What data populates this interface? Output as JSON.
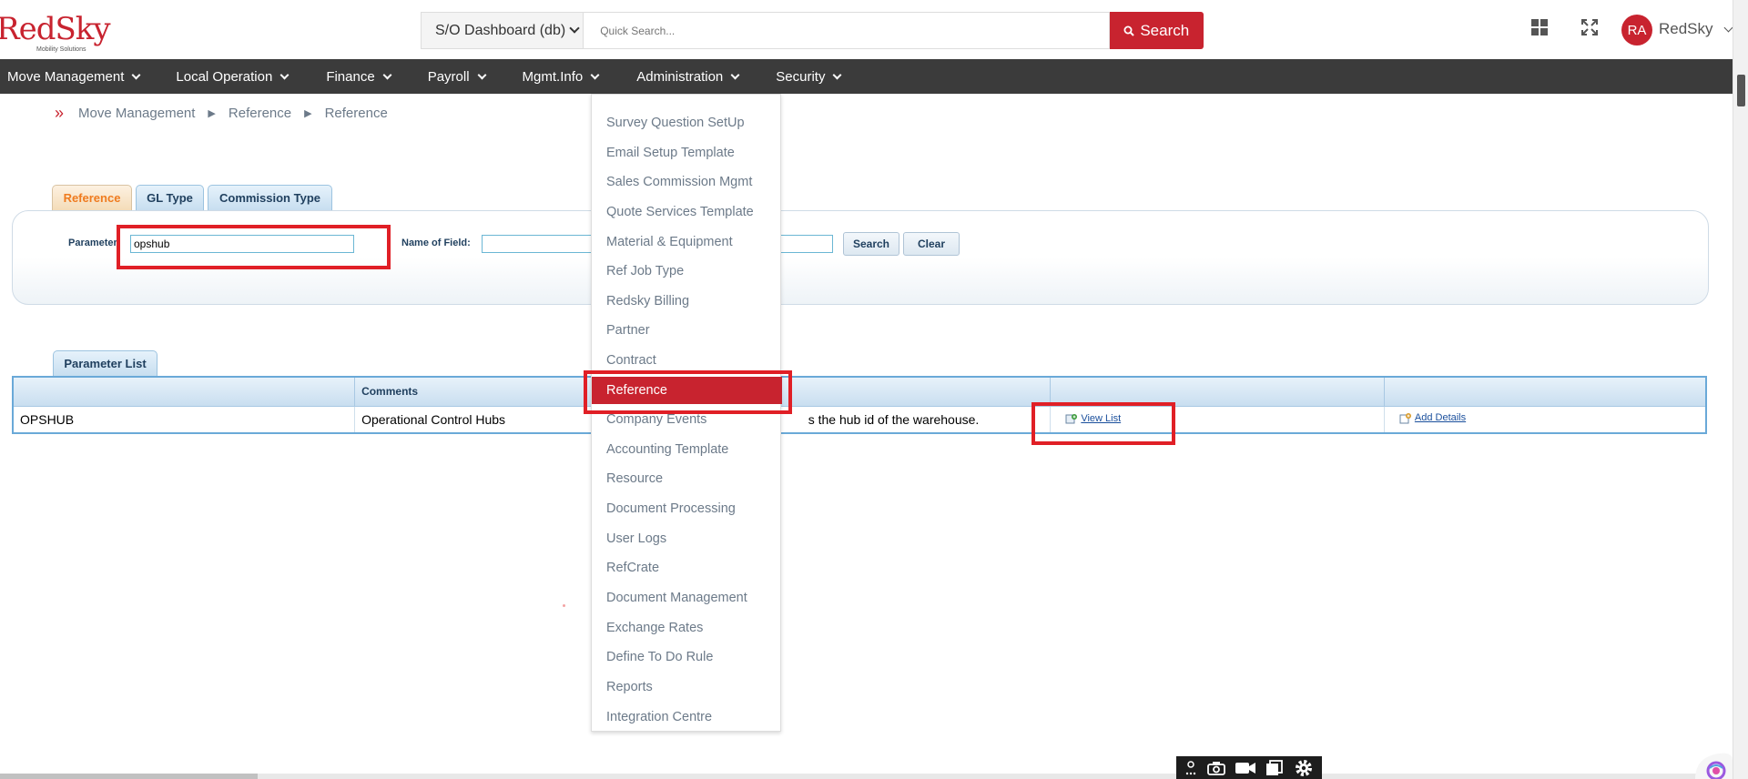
{
  "logo": {
    "brand_red": "Red",
    "brand_sky": "Sky",
    "tagline": "Mobility Solutions"
  },
  "header": {
    "dashboard_select": "S/O Dashboard (db)",
    "quick_search_placeholder": "Quick Search...",
    "search_button": "Search",
    "avatar_initials": "RA",
    "user_name": "RedSky"
  },
  "nav": {
    "items": [
      "Move Management",
      "Local Operation",
      "Finance",
      "Payroll",
      "Mgmt.Info",
      "Administration",
      "Security"
    ]
  },
  "breadcrumb": {
    "items": [
      "Move Management",
      "Reference",
      "Reference"
    ]
  },
  "tabs": [
    "Reference",
    "GL Type",
    "Commission Type"
  ],
  "filter": {
    "parameter_label": "Parameter:",
    "parameter_value": "opshub",
    "name_of_field_label": "Name of Field:",
    "name_of_field_value": "",
    "search_button": "Search",
    "clear_button": "Clear"
  },
  "parameter_list": {
    "tab_label": "Parameter List",
    "headers": [
      "",
      "Comments",
      "",
      "",
      ""
    ],
    "row": {
      "parameter": "OPSHUB",
      "comments": "Operational Control Hubs",
      "description": "s the hub id of the warehouse.",
      "view_list": "View List",
      "add_details": "Add Details"
    }
  },
  "administration_menu": {
    "items": [
      "Survey Question SetUp",
      "Email Setup Template",
      "Sales Commission Mgmt",
      "Quote Services Template",
      "Material & Equipment",
      "Ref Job Type",
      "Redsky Billing",
      "Partner",
      "Contract",
      "Reference",
      "Company Events",
      "Accounting Template",
      "Resource",
      "Document Processing",
      "User Logs",
      "RefCrate",
      "Document Management",
      "Exchange Rates",
      "Define To Do Rule",
      "Reports",
      "Integration Centre"
    ],
    "active": "Reference"
  },
  "colors": {
    "brand_red": "#c8232f",
    "nav_bg": "#3b3b3b",
    "highlight_border": "#e01f26",
    "active_tab_text": "#ef7b1f",
    "link_blue": "#1a4f9c"
  }
}
